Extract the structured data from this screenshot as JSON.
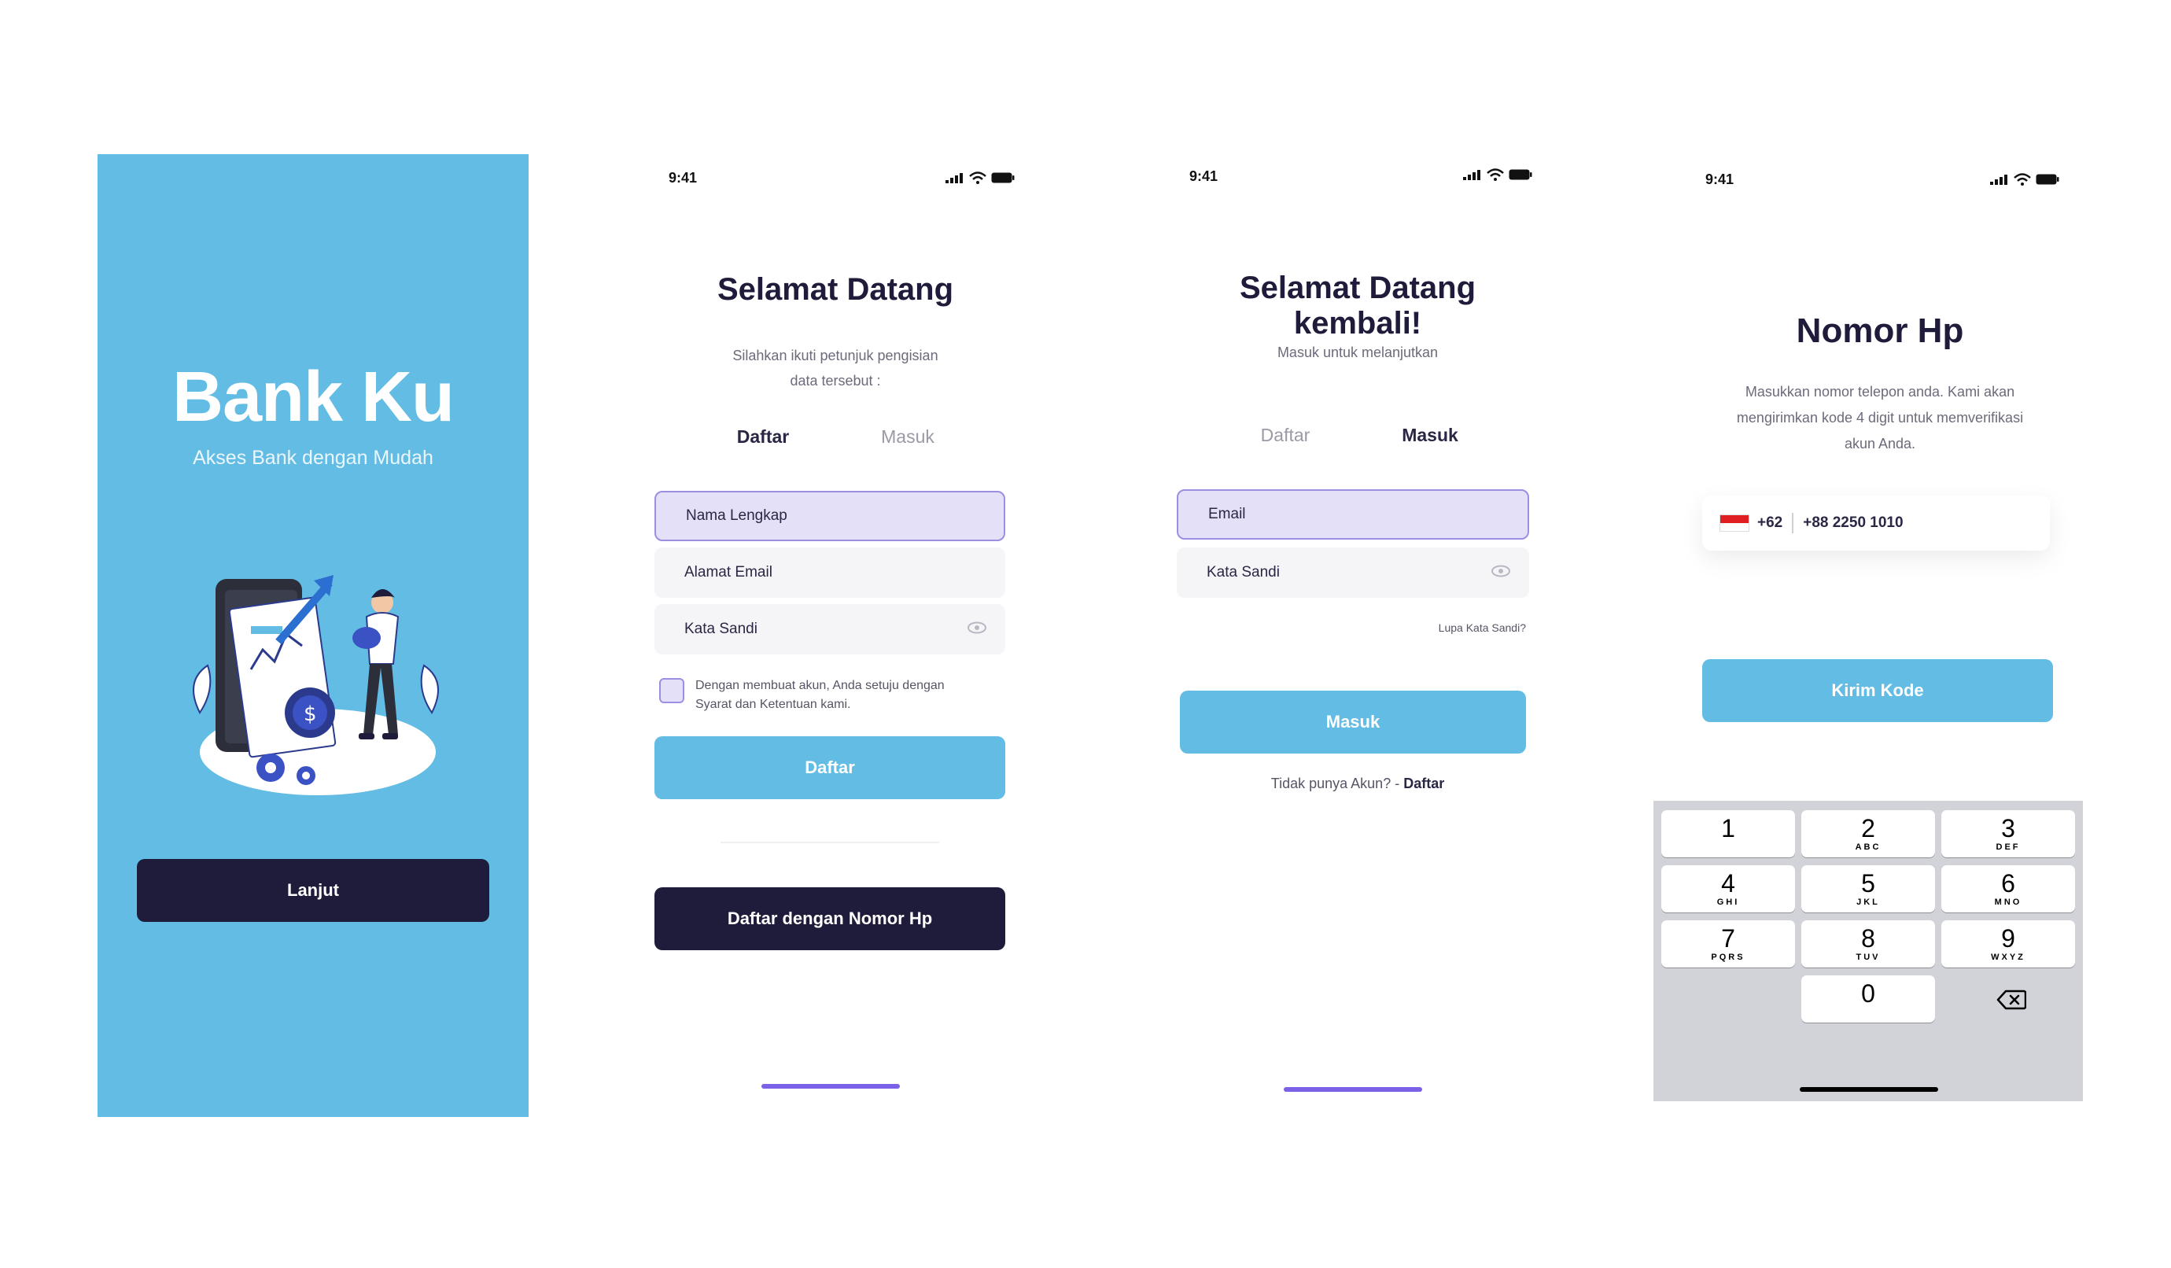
{
  "splash": {
    "brand": "Bank Ku",
    "tagline": "Akses Bank dengan Mudah",
    "continue_label": "Lanjut"
  },
  "status": {
    "time": "9:41"
  },
  "daftar_screen": {
    "title": "Selamat Datang",
    "subtitle_line1": "Silahkan ikuti petunjuk pengisian",
    "subtitle_line2": "data tersebut :",
    "tab_daftar": "Daftar",
    "tab_masuk": "Masuk",
    "name_placeholder": "Nama Lengkap",
    "email_placeholder": "Alamat Email",
    "password_placeholder": "Kata Sandi",
    "terms_line1": "Dengan membuat akun, Anda setuju dengan",
    "terms_line2": "Syarat dan Ketentuan kami.",
    "submit_label": "Daftar",
    "phone_signup_label": "Daftar dengan Nomor Hp"
  },
  "masuk_screen": {
    "title": "Selamat Datang kembali!",
    "subtitle": "Masuk untuk melanjutkan",
    "tab_daftar": "Daftar",
    "tab_masuk": "Masuk",
    "email_placeholder": "Email",
    "password_placeholder": "Kata Sandi",
    "forgot_label": "Lupa Kata Sandi?",
    "submit_label": "Masuk",
    "no_account_text": "Tidak punya Akun? - ",
    "signup_link": "Daftar"
  },
  "phone_screen": {
    "title": "Nomor Hp",
    "subtitle_line1": "Masukkan nomor telepon anda. Kami akan",
    "subtitle_line2": "mengirimkan kode 4 digit untuk memverifikasi",
    "subtitle_line3": "akun Anda.",
    "country_code": "+62",
    "phone_value": "+88 2250 1010",
    "send_code_label": "Kirim Kode"
  },
  "keypad": [
    {
      "num": "1",
      "letters": ""
    },
    {
      "num": "2",
      "letters": "ABC"
    },
    {
      "num": "3",
      "letters": "DEF"
    },
    {
      "num": "4",
      "letters": "GHI"
    },
    {
      "num": "5",
      "letters": "JKL"
    },
    {
      "num": "6",
      "letters": "MNO"
    },
    {
      "num": "7",
      "letters": "PQRS"
    },
    {
      "num": "8",
      "letters": "TUV"
    },
    {
      "num": "9",
      "letters": "WXYZ"
    },
    {
      "num": "0",
      "letters": ""
    }
  ],
  "colors": {
    "primary_blue": "#63bce3",
    "dark_navy": "#1f1b3a",
    "accent_purple": "#7b61e8",
    "focused_field": "#e4e0f8"
  }
}
